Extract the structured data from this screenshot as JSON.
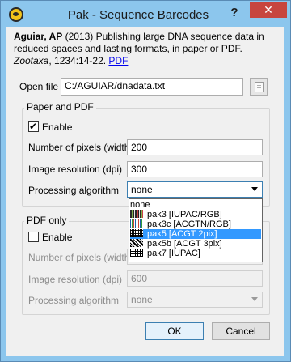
{
  "window": {
    "title": "Pak - Sequence Barcodes",
    "help": "?",
    "close": "✕"
  },
  "citation": {
    "author": "Aguiar, AP",
    "year_text": " (2013) Publishing large DNA sequence data in reduced spaces and lasting formats, in paper or PDF. ",
    "journal": "Zootaxa",
    "pages": ", 1234:14-22. ",
    "link": "PDF"
  },
  "open_file": {
    "label": "Open file",
    "value": "C:/AGUIAR/dnadata.txt"
  },
  "paper_pdf": {
    "title": "Paper and PDF",
    "enable_label": "Enable",
    "enabled": true,
    "width_label": "Number of pixels (width)",
    "width_value": "200",
    "resolution_label": "Image resolution (dpi)",
    "resolution_value": "300",
    "algorithm_label": "Processing algorithm",
    "algorithm_value": "none"
  },
  "dropdown": {
    "options": [
      {
        "label": "none",
        "icon": "none"
      },
      {
        "label": "pak3 [IUPAC/RGB]",
        "icon": "pak3-barcode-icon"
      },
      {
        "label": "pak3c [ACGTN/RGB]",
        "icon": "pak3c-barcode-icon"
      },
      {
        "label": "pak5 [ACGT 2pix]",
        "icon": "pak5-barcode-icon",
        "selected": true
      },
      {
        "label": "pak5b [ACGT 3pix]",
        "icon": "pak5b-barcode-icon"
      },
      {
        "label": "pak7 [IUPAC]",
        "icon": "pak7-barcode-icon"
      }
    ],
    "selected_color": "#3399ff"
  },
  "pdf_only": {
    "title": "PDF only",
    "enable_label": "Enable",
    "enabled": false,
    "width_label": "Number of pixels (width)",
    "resolution_label": "Image resolution (dpi)",
    "resolution_value": "600",
    "algorithm_label": "Processing algorithm",
    "algorithm_value": "none"
  },
  "buttons": {
    "ok": "OK",
    "cancel": "Cancel"
  },
  "colors": {
    "titlebar": "#8cc6ed",
    "close": "#c7453e",
    "link": "#0000ee"
  }
}
